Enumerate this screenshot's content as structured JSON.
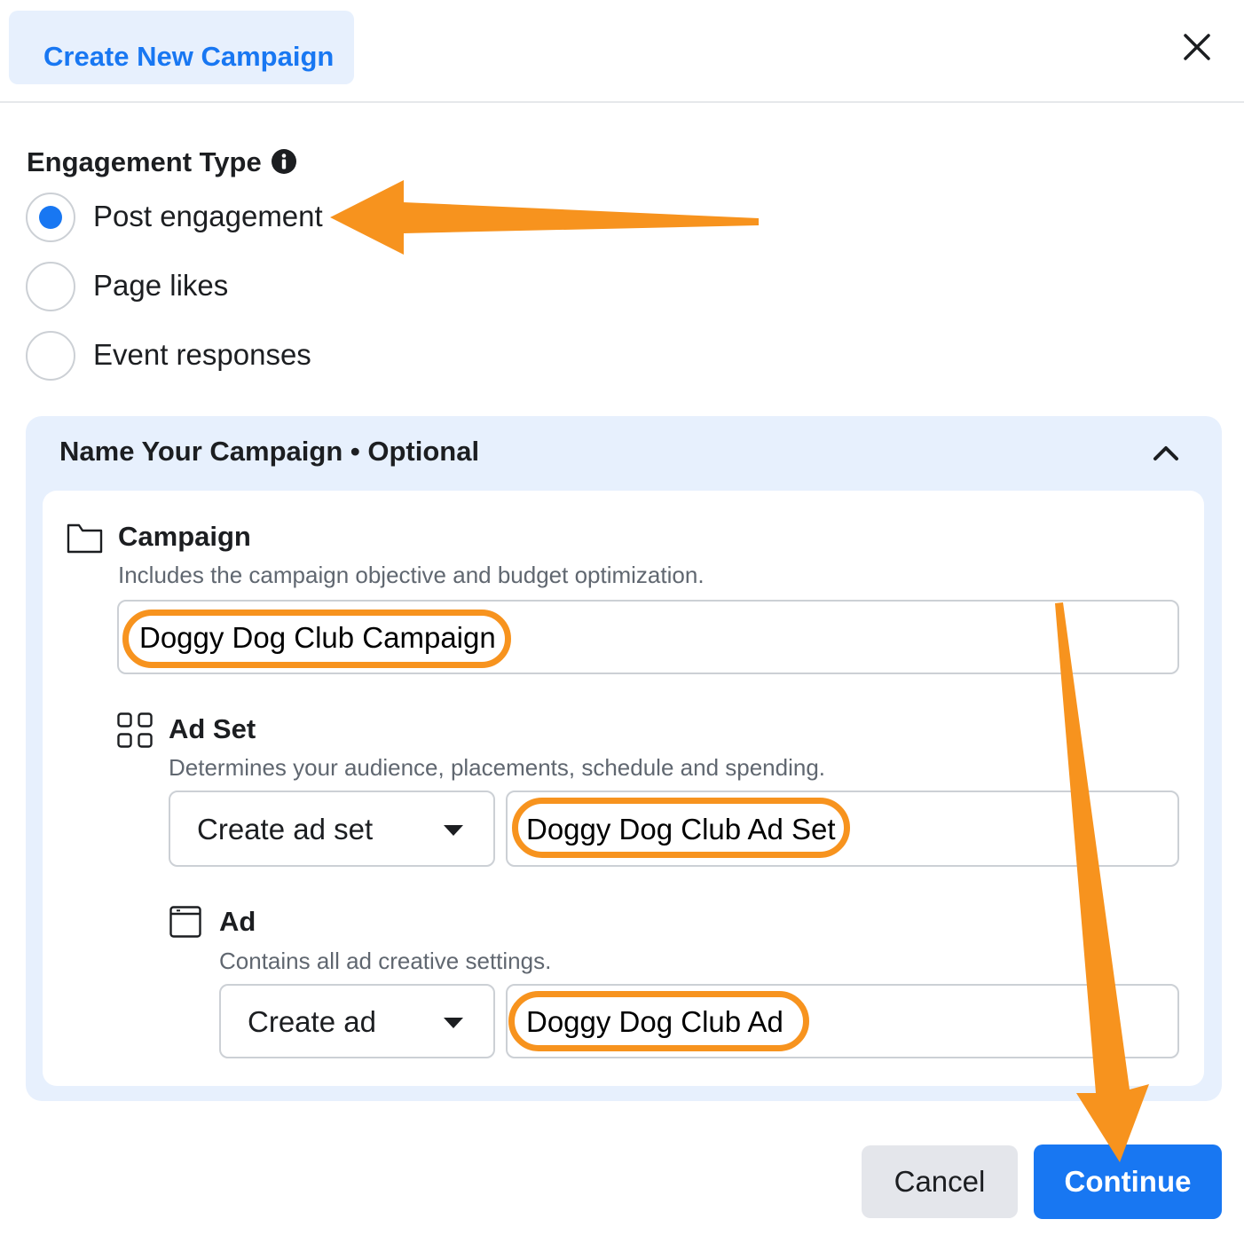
{
  "header": {
    "title": "Create New Campaign",
    "close_icon": "close-icon"
  },
  "engagement": {
    "label": "Engagement Type",
    "info_icon": "info-icon",
    "options": [
      {
        "label": "Post engagement",
        "selected": true
      },
      {
        "label": "Page likes",
        "selected": false
      },
      {
        "label": "Event responses",
        "selected": false
      }
    ]
  },
  "naming": {
    "title": "Name Your Campaign • Optional",
    "collapse_icon": "chevron-up-icon",
    "campaign": {
      "icon": "folder-icon",
      "title": "Campaign",
      "description": "Includes the campaign objective and budget optimization.",
      "value": "Doggy Dog Club Campaign"
    },
    "ad_set": {
      "icon": "grid-icon",
      "title": "Ad Set",
      "description": "Determines your audience, placements, schedule and spending.",
      "select_value": "Create ad set",
      "value": "Doggy Dog Club Ad Set"
    },
    "ad": {
      "icon": "window-icon",
      "title": "Ad",
      "description": "Contains all ad creative settings.",
      "select_value": "Create ad",
      "value": "Doggy Dog Club Ad"
    }
  },
  "footer": {
    "cancel_label": "Cancel",
    "continue_label": "Continue"
  },
  "colors": {
    "accent": "#1877f2",
    "panel_background": "#e7f0fd",
    "annotation": "#f7931e"
  }
}
